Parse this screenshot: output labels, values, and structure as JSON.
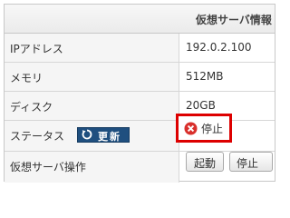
{
  "header": {
    "title": "仮想サーバ情報"
  },
  "rows": [
    {
      "label": "IPアドレス",
      "value": "192.0.2.100"
    },
    {
      "label": "メモリ",
      "value": "512MB"
    },
    {
      "label": "ディスク",
      "value": "20GB"
    },
    {
      "label": "ステータス",
      "refresh_label": "更新",
      "status": "停止"
    },
    {
      "label": "仮想サーバ操作",
      "start_label": "起動",
      "stop_label": "停止"
    }
  ],
  "colors": {
    "refresh_button": "#1f4f7f",
    "status_highlight": "#dd0000",
    "stop_icon": "#d9302c"
  },
  "icons": {
    "refresh": "refresh-icon",
    "status": "stop-icon"
  }
}
